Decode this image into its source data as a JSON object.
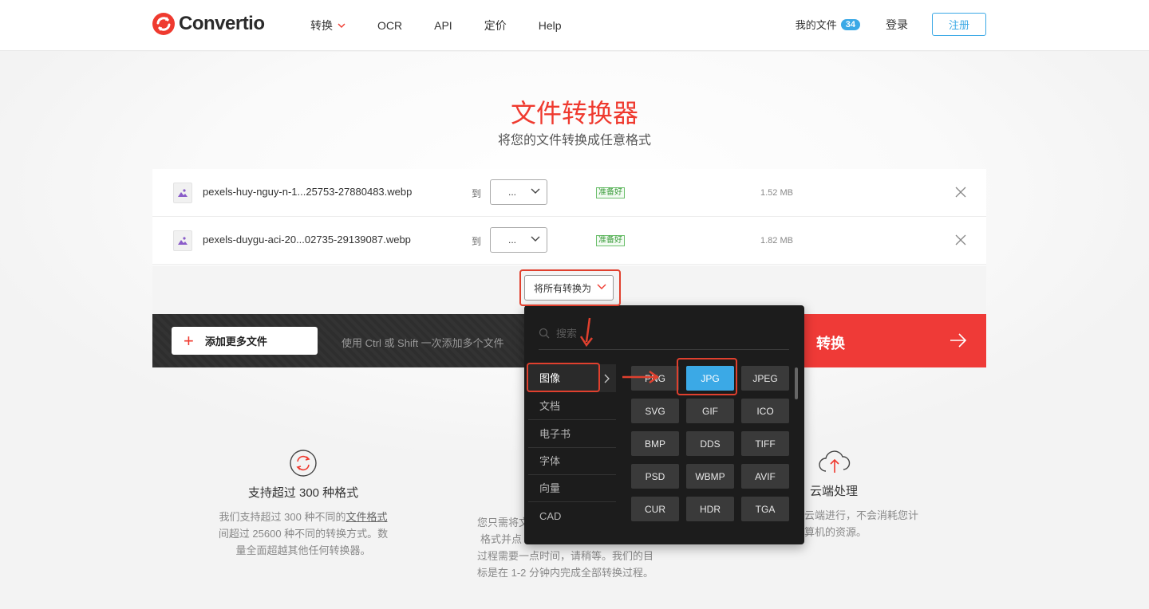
{
  "brand": {
    "name": "Convertio",
    "accent": "#ef3a2f",
    "blue": "#3ba9e6"
  },
  "nav": {
    "items": [
      {
        "label": "转换",
        "has_dropdown": true
      },
      {
        "label": "OCR"
      },
      {
        "label": "API"
      },
      {
        "label": "定价"
      },
      {
        "label": "Help"
      }
    ],
    "my_files": "我的文件",
    "my_files_count": "34",
    "login": "登录",
    "signup": "注册"
  },
  "hero": {
    "title": "文件转换器",
    "subtitle": "将您的文件转换成任意格式"
  },
  "files": [
    {
      "name": "pexels-huy-nguy-n-1...25753-27880483.webp",
      "to": "到",
      "target": "...",
      "status": "准备好",
      "size": "1.52 MB"
    },
    {
      "name": "pexels-duygu-aci-20...02735-29139087.webp",
      "to": "到",
      "target": "...",
      "status": "准备好",
      "size": "1.82 MB"
    }
  ],
  "convert_all": {
    "label": "将所有转换为"
  },
  "actions": {
    "add_more": "添加更多文件",
    "hint": "使用 Ctrl 或 Shift 一次添加多个文件",
    "convert": "转换"
  },
  "dropdown": {
    "search_placeholder": "搜索",
    "categories": [
      "图像",
      "文档",
      "电子书",
      "字体",
      "向量",
      "CAD"
    ],
    "active_category": "图像",
    "formats": [
      "PNG",
      "JPG",
      "JPEG",
      "SVG",
      "GIF",
      "ICO",
      "BMP",
      "DDS",
      "TIFF",
      "PSD",
      "WBMP",
      "AVIF",
      "CUR",
      "HDR",
      "TGA"
    ],
    "selected_format": "JPG"
  },
  "features": [
    {
      "icon": "refresh-icon",
      "title": "支持超过 300 种格式",
      "lines": [
        "我们支持超过 300 种不同的",
        "文件格式",
        "间超过 25600 种不同的转换方式。数",
        "量全面超越其他任何转换器。"
      ]
    },
    {
      "icon": "clock-icon",
      "lines": [
        "您只需将文",
        "格式并点",
        "过程需要一点时间，请稍等。我们的目",
        "标是在 1-2 分钟内完成全部转换过程。"
      ]
    },
    {
      "icon": "cloud-icon",
      "title": "云端处理",
      "lines": [
        "云端进行，不会消耗您计",
        "算机的资源。"
      ]
    }
  ]
}
